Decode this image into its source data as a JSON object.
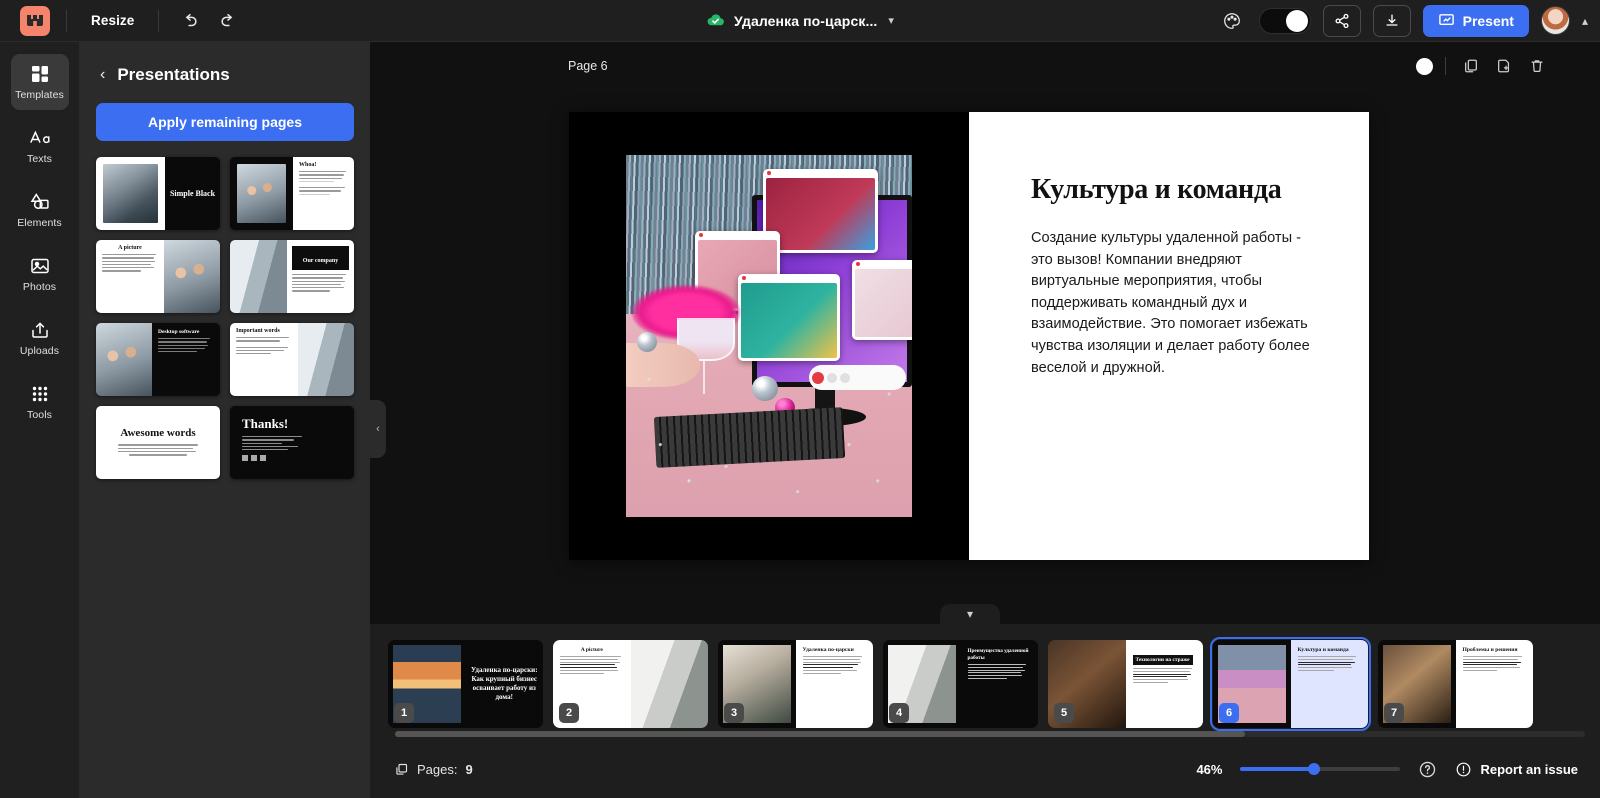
{
  "topbar": {
    "logo_icon": "crown-logo-icon",
    "resize_label": "Resize",
    "undo_icon": "undo-icon",
    "redo_icon": "redo-icon",
    "save_status_icon": "cloud-check-icon",
    "doc_title": "Удаленка по-царск...",
    "title_chevron": "chevron-down-icon",
    "palette_icon": "palette-icon",
    "theme_toggle_icon": "dark-light-toggle",
    "share_icon": "share-icon",
    "download_icon": "download-icon",
    "present_label": "Present",
    "present_icon": "presentation-icon",
    "avatar_icon": "user-avatar",
    "account_chevron": "chevron-up-icon",
    "accent_color": "#3b6ef0"
  },
  "rail": {
    "items": [
      {
        "label": "Templates",
        "icon": "grid-layout-icon",
        "active": true
      },
      {
        "label": "Texts",
        "icon": "text-aa-icon",
        "active": false
      },
      {
        "label": "Elements",
        "icon": "shapes-icon",
        "active": false
      },
      {
        "label": "Photos",
        "icon": "image-icon",
        "active": false
      },
      {
        "label": "Uploads",
        "icon": "upload-icon",
        "active": false
      },
      {
        "label": "Tools",
        "icon": "dots-grid-icon",
        "active": false
      }
    ]
  },
  "panel": {
    "back_icon": "chevron-left-icon",
    "title": "Presentations",
    "apply_label": "Apply remaining pages",
    "collapse_icon": "chevron-left-icon",
    "templates": [
      {
        "title": "Simple Black",
        "layout": "photo-left-black-right"
      },
      {
        "title": "Whoa!",
        "layout": "photo-left-white-right"
      },
      {
        "title": "A picture",
        "layout": "white-left-photo-right"
      },
      {
        "title": "Our company",
        "layout": "photo-left-white-right"
      },
      {
        "title": "Desktop software",
        "layout": "photo-left-black-right"
      },
      {
        "title": "Important words",
        "layout": "white-left-photo-right"
      },
      {
        "title": "Awesome words",
        "layout": "white-full"
      },
      {
        "title": "Thanks!",
        "layout": "black-full"
      }
    ]
  },
  "canvas": {
    "page_label": "Page 6",
    "color_dot_icon": "slide-color-dot",
    "duplicate_icon": "duplicate-page-icon",
    "addpage_icon": "add-page-icon",
    "delete_icon": "trash-icon",
    "slide": {
      "heading": "Культура и команда",
      "body": "Создание культуры удаленной работы - это вызов! Компании внедряют виртуальные мероприятия, чтобы поддерживать командный дух и взаимодействие. Это помогает избежать чувства изоляции и делает работу более веселой и дружной.",
      "image_alt": "virtual-party-video-call-photo"
    }
  },
  "filmstrip": {
    "collapse_icon": "chevron-down-icon",
    "slides": [
      {
        "num": "1",
        "title": "Удаленка по-царски: Как крупный бизнес осваивает работу из дома!",
        "layout": "photo-left-black-right",
        "photo": "sunset",
        "selected": false
      },
      {
        "num": "2",
        "title": "A picture",
        "layout": "white-left-photo-right",
        "photo": "office2",
        "selected": false
      },
      {
        "num": "3",
        "title": "Удаленка по-царски",
        "layout": "photo-left-white-right",
        "photo": "desk",
        "selected": false
      },
      {
        "num": "4",
        "title": "Преимущества удаленной работы",
        "layout": "photo-left-black-right",
        "photo": "office2",
        "selected": false
      },
      {
        "num": "5",
        "title": "Технологии на страже",
        "layout": "photo-left-white-right",
        "photo": "dark",
        "selected": false
      },
      {
        "num": "6",
        "title": "Культура и команда",
        "layout": "photo-left-lavender-right",
        "photo": "party",
        "selected": true
      },
      {
        "num": "7",
        "title": "Проблемы и решения",
        "layout": "photo-left-white-right",
        "photo": "woman",
        "selected": false
      }
    ]
  },
  "bottombar": {
    "pages_icon": "pages-copy-icon",
    "pages_label": "Pages:",
    "pages_count": "9",
    "zoom_value": "46%",
    "zoom_percent": 46,
    "help_icon": "question-circle-icon",
    "report_icon": "exclamation-circle-icon",
    "report_label": "Report an issue"
  }
}
